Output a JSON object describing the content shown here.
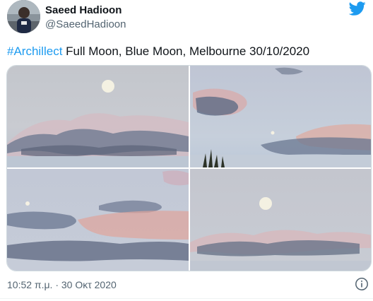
{
  "author": {
    "display_name": "Saeed Hadioon",
    "handle": "@SaeedHadioon"
  },
  "tweet": {
    "hashtag": "#Archillect",
    "text": " Full Moon,  Blue Moon,  Melbourne 30/10/2020"
  },
  "icons": {
    "brand": "twitter-bird-icon",
    "info": "info-icon"
  },
  "timestamp": "10:52 π.μ. · 30 Οκτ 2020",
  "colors": {
    "link": "#1d9bf0",
    "secondary_text": "#536471",
    "brand": "#1d9bf0"
  }
}
